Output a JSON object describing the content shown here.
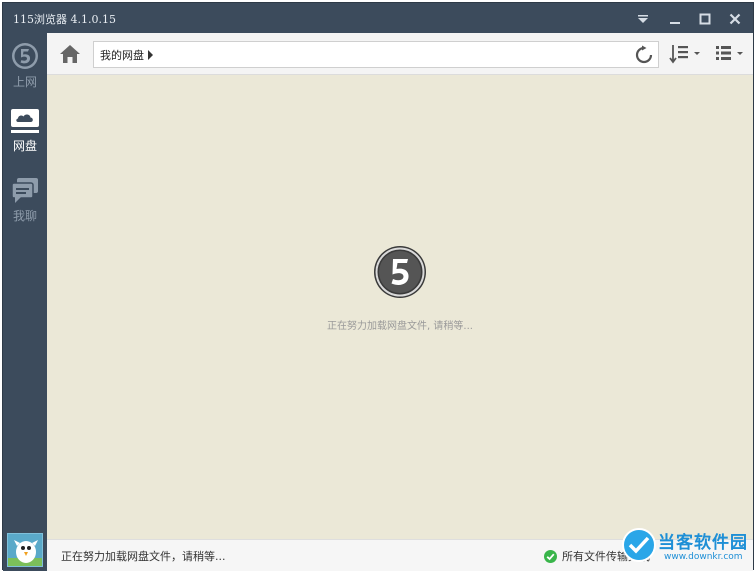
{
  "window": {
    "title": "115浏览器 4.1.0.15"
  },
  "sidebar": {
    "items": [
      {
        "label": "上网",
        "icon": "browse-5-icon",
        "active": false
      },
      {
        "label": "网盘",
        "icon": "cloud-disk-icon",
        "active": true
      },
      {
        "label": "我聊",
        "icon": "chat-icon",
        "active": false
      }
    ]
  },
  "toolbar": {
    "breadcrumb": "我的网盘"
  },
  "main": {
    "loading_text": "正在努力加载网盘文件, 请稍等..."
  },
  "statusbar": {
    "left_text": "正在努力加载网盘文件，请稍等...",
    "right_text": "所有文件传输完成"
  },
  "watermark": {
    "title": "当客软件园",
    "url": "www.downkr.com"
  },
  "colors": {
    "chrome": "#3c4b5c",
    "content_bg": "#ebe8d7",
    "accent_green": "#39b54a",
    "watermark_blue": "#1e8fd6"
  }
}
